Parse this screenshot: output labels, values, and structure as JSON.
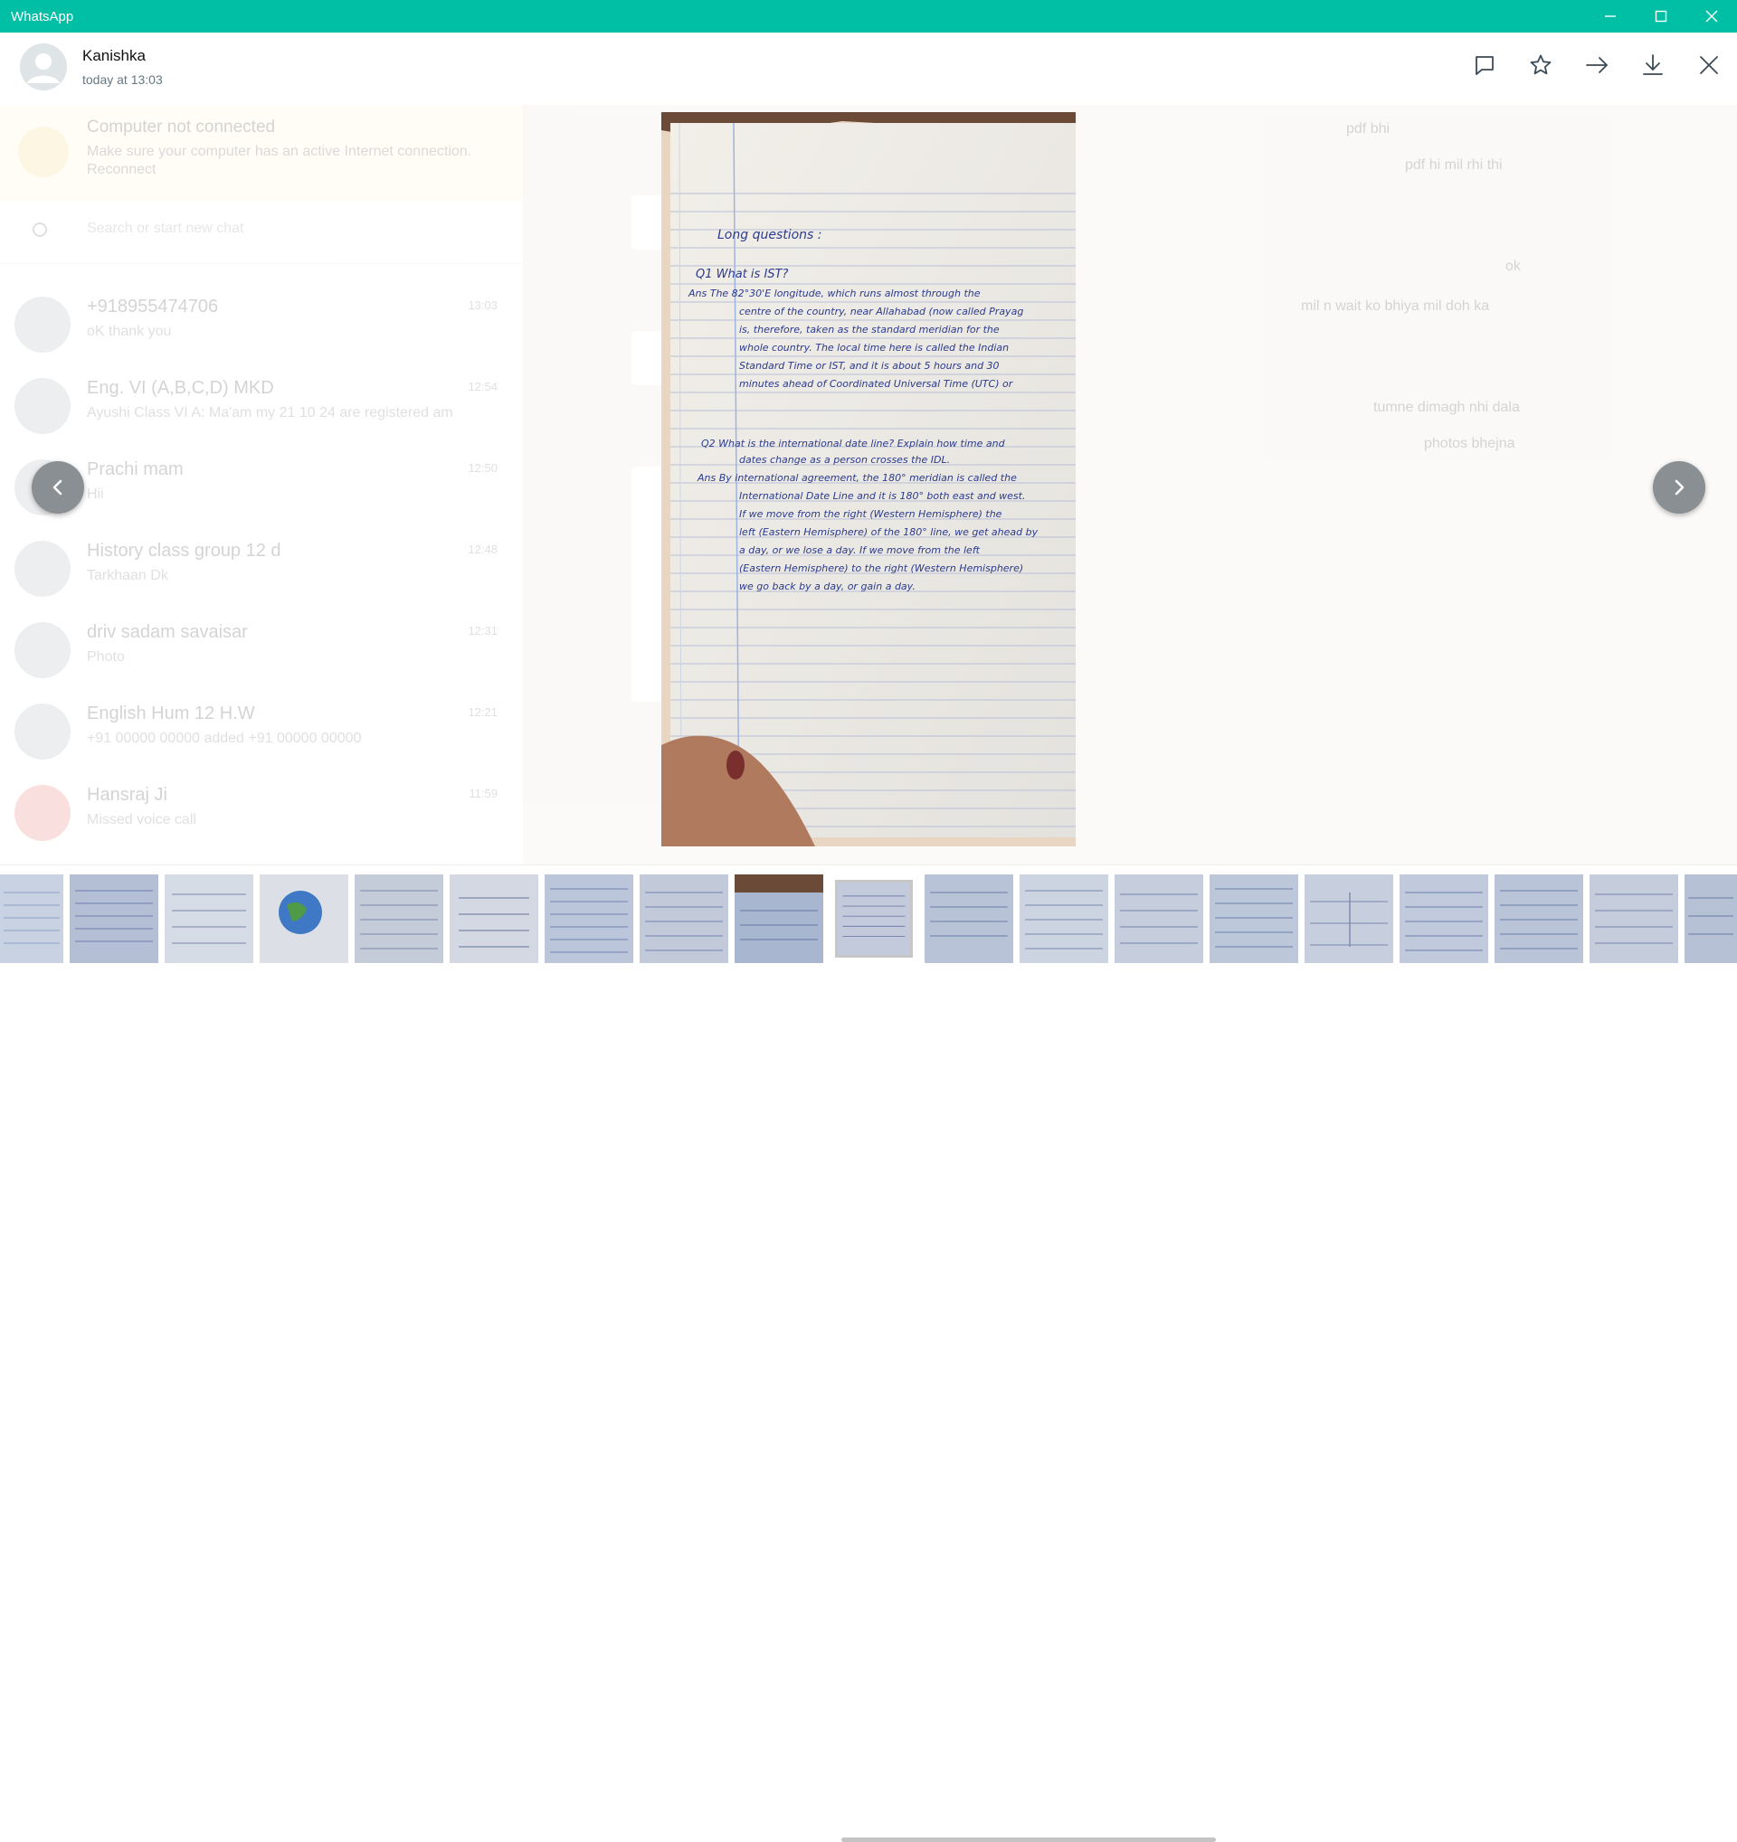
{
  "window": {
    "title": "WhatsApp",
    "minimize_icon": "minimize-icon",
    "maximize_icon": "maximize-icon",
    "close_icon": "close-icon"
  },
  "viewer": {
    "sender_name": "Kanishka",
    "timestamp": "today at 13:03",
    "actions": [
      "reply-icon",
      "star-icon",
      "forward-icon",
      "download-icon",
      "close-icon"
    ]
  },
  "background": {
    "banner_title": "Computer not connected",
    "banner_text": "Make sure your computer has an active Internet connection.",
    "banner_link": "Reconnect",
    "search_placeholder": "Search or start new chat",
    "chats": [
      {
        "name": "+918955474706",
        "message": "oK thank you",
        "time": "13:03"
      },
      {
        "name": "Eng. VI (A,B,C,D) MKD",
        "message": "Ayushi Class VI A: Ma'am my 21 10 24 are registered am",
        "time": "12:54"
      },
      {
        "name": "Prachi mam",
        "message": "Hii",
        "time": "12:50"
      },
      {
        "name": "History class group 12 d",
        "message": "Tarkhaan Dk",
        "time": "12:48"
      },
      {
        "name": "driv sadam savaisar",
        "message": "Photo",
        "time": "12:31"
      },
      {
        "name": "English Hum 12 H.W",
        "message": "+91 00000 00000 added +91 00000 00000",
        "time": "12:21"
      },
      {
        "name": "Hansraj Ji",
        "message": "Missed voice call",
        "time": "11:59"
      }
    ],
    "messages": [
      "pdf bhi",
      "pdf hi mil rhi thi",
      "ok",
      "mil n wait ko bhiya mil doh ka",
      "tumne dimagh nhi dala",
      "photos bhejna"
    ]
  },
  "photo": {
    "heading": "Long questions :",
    "q1": "Q1 What is IST?",
    "a1": [
      "Ans The 82°30'E longitude, which runs almost through the",
      "centre of the country, near Allahabad (now called Prayag",
      "is, therefore, taken as the standard meridian for the",
      "whole country. The local time here is called the Indian",
      "Standard Time or IST, and it is about 5 hours and 30",
      "minutes ahead of Coordinated Universal Time (UTC) or"
    ],
    "q2": [
      "Q2 What is the international date line? Explain how time and",
      "dates change as a person crosses the IDL."
    ],
    "a2": [
      "Ans By international agreement, the 180° meridian is called the",
      "International Date Line and it is 180° both east and west.",
      "If we move from the right (Western Hemisphere) the",
      "left (Eastern Hemisphere) of the 180° line, we get ahead by",
      "a day, or we lose a day. If we move from the left",
      "(Eastern Hemisphere) to the right (Western Hemisphere)",
      "we go back by a day, or gain a day."
    ]
  },
  "navigation": {
    "prev_icon": "chevron-left-icon",
    "next_icon": "chevron-right-icon"
  },
  "thumbnails": {
    "count": 19,
    "active_index": 9
  }
}
